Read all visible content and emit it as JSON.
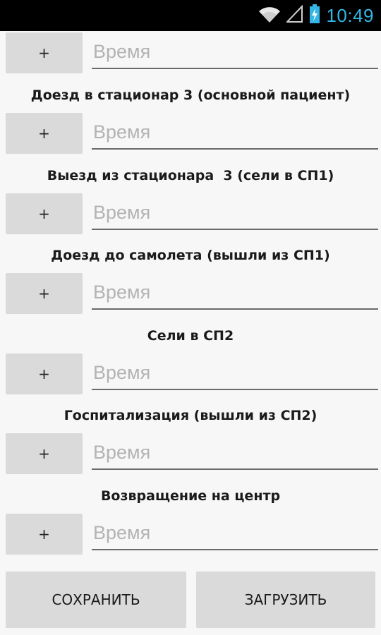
{
  "status_bar": {
    "time": "10:49",
    "icons": [
      "wifi-icon",
      "signal-icon",
      "battery-charging-icon"
    ],
    "clock_color": "#33b5e5"
  },
  "rows": [
    {
      "button_label": "+",
      "placeholder": "Время",
      "label": ""
    },
    {
      "button_label": "+",
      "placeholder": "Время",
      "label": "Доезд в стационар 3 (основной пациент)"
    },
    {
      "button_label": "+",
      "placeholder": "Время",
      "label": "Выезд из стационара  3 (сели в СП1)"
    },
    {
      "button_label": "+",
      "placeholder": "Время",
      "label": "Доезд до самолета (вышли из СП1)"
    },
    {
      "button_label": "+",
      "placeholder": "Время",
      "label": "Сели в СП2"
    },
    {
      "button_label": "+",
      "placeholder": "Время",
      "label": "Госпитализация (вышли из СП2)"
    },
    {
      "button_label": "+",
      "placeholder": "Время",
      "label": "Возвращение на центр"
    }
  ],
  "actions": {
    "save_label": "СОХРАНИТЬ",
    "load_label": "ЗАГРУЗИТЬ"
  }
}
